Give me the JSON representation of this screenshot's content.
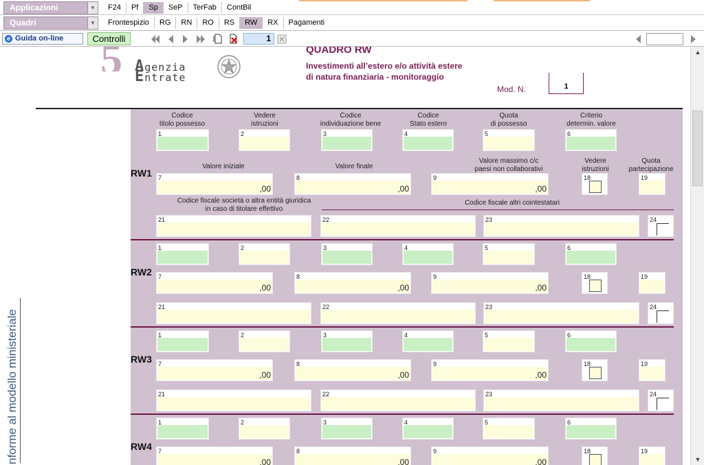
{
  "menu": {
    "applicazioni": "Applicazioni",
    "quadri": "Quadri",
    "top_tabs": [
      {
        "label": "F24",
        "active": false
      },
      {
        "label": "Pf",
        "active": false
      },
      {
        "label": "Sp",
        "active": true
      },
      {
        "label": "SeP",
        "active": false
      },
      {
        "label": "TerFab",
        "active": false
      },
      {
        "label": "ContBil",
        "active": false
      }
    ],
    "quadri_tabs": [
      {
        "label": "Frontespizio",
        "active": false
      },
      {
        "label": "RG",
        "active": false
      },
      {
        "label": "RN",
        "active": false
      },
      {
        "label": "RO",
        "active": false
      },
      {
        "label": "RS",
        "active": false
      },
      {
        "label": "RW",
        "active": true
      },
      {
        "label": "RX",
        "active": false
      },
      {
        "label": "Pagamenti",
        "active": false
      }
    ]
  },
  "toolbar": {
    "help_label": "Guida on-line",
    "controlli_label": "Controlli",
    "page_number": "1",
    "right_field_value": ""
  },
  "document": {
    "left_vertical_text": "nforme al modello ministeriale",
    "logo": {
      "agenzia": "genzia",
      "entrate": "ntrate"
    },
    "quadro_title": "QUADRO RW",
    "quadro_subtitle_1": "Investimenti all’estero e/o attività estere",
    "quadro_subtitle_2": "di natura finanziaria - monitoraggio",
    "mod_label": "Mod. N.",
    "mod_value": "1"
  },
  "form": {
    "headers_top": {
      "h1": "Codice\ntitolo possesso",
      "h2": "Vedere\nistruzioni",
      "h3": "Codice\nindividuazione bene",
      "h4": "Codice\nStato estero",
      "h5": "Quota\ndi possesso",
      "h6": "Criterio\ndetermin. valore"
    },
    "headers_mid": {
      "h7": "Valore iniziale",
      "h8": "Valore finale",
      "h9": "Valore massimo c/c\npaesi non collaborativi",
      "h18": "Vedere\nistruzioni",
      "h19": "Quota\npartecipazione"
    },
    "headers_bottom": {
      "h21": "Codice fiscale società o altra entità giuridica\nin caso di titolare effettivo",
      "h22": "Codice fiscale altri cointestatari"
    },
    "decimals": ",00",
    "rows": [
      {
        "label": "RW1"
      },
      {
        "label": "RW2"
      },
      {
        "label": "RW3"
      },
      {
        "label": "RW4"
      }
    ],
    "field_numbers": {
      "f1": "1",
      "f2": "2",
      "f3": "3",
      "f4": "4",
      "f5": "5",
      "f6": "6",
      "f7": "7",
      "f8": "8",
      "f9": "9",
      "f18": "18",
      "f19": "19",
      "f21": "21",
      "f22": "22",
      "f23": "23",
      "f24": "24"
    }
  }
}
